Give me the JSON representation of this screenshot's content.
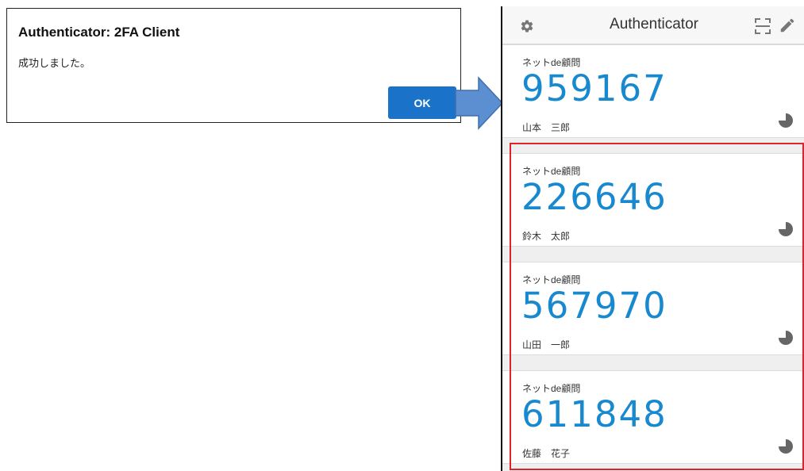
{
  "dialog": {
    "title": "Authenticator: 2FA Client",
    "message": "成功しました。",
    "ok_label": "OK"
  },
  "app": {
    "title": "Authenticator",
    "icons": {
      "settings": "gear-icon",
      "scan": "scan-icon",
      "edit": "pencil-icon",
      "timer": "pie-timer-icon"
    }
  },
  "entries": [
    {
      "issuer": "ネットde顧問",
      "code": "959167",
      "account": "山本　三郎"
    },
    {
      "issuer": "ネットde顧問",
      "code": "226646",
      "account": "鈴木　太郎"
    },
    {
      "issuer": "ネットde顧問",
      "code": "567970",
      "account": "山田　一郎"
    },
    {
      "issuer": "ネットde顧問",
      "code": "611848",
      "account": "佐藤　花子"
    }
  ],
  "colors": {
    "code": "#1889cf",
    "ok_button": "#1a73c9",
    "highlight": "#e0222a",
    "arrow": "#5b8fd1"
  }
}
